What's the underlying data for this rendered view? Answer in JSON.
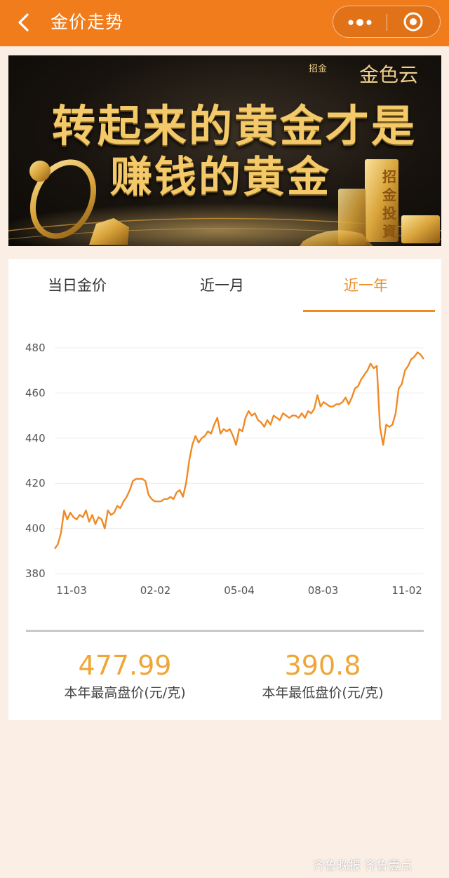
{
  "header": {
    "title": "金价走势",
    "back_icon": "chevron-left-icon",
    "more_icon": "more-dots-icon",
    "close_icon": "target-close-icon",
    "background": "#f07c1c"
  },
  "banner": {
    "badge": "招金",
    "brand": "金色云",
    "headline_1": "转起来的黄金才是",
    "headline_2": "赚钱的黄金",
    "gold_bar_text": "招金投資"
  },
  "tabs": [
    {
      "label": "当日金价",
      "active": false
    },
    {
      "label": "近一月",
      "active": false
    },
    {
      "label": "近一年",
      "active": true
    }
  ],
  "accent_color": "#f08a24",
  "chart_data": {
    "type": "line",
    "title": "",
    "xlabel": "",
    "ylabel": "",
    "ylim": [
      380,
      480
    ],
    "yticks": [
      380,
      400,
      420,
      440,
      460,
      480
    ],
    "xtick_labels": [
      "11-03",
      "02-02",
      "05-04",
      "08-03",
      "11-02"
    ],
    "grid": true,
    "series": [
      {
        "color": "#f08a24",
        "values": [
          391,
          393,
          398,
          408,
          404,
          407,
          405,
          404,
          406,
          405,
          408,
          403,
          406,
          402,
          405,
          404,
          400,
          408,
          406,
          407,
          410,
          409,
          412,
          414,
          417,
          421,
          422,
          422,
          422,
          421,
          415,
          413,
          412,
          412,
          412,
          413,
          413,
          414,
          413,
          416,
          417,
          414,
          420,
          430,
          437,
          441,
          438,
          440,
          441,
          443,
          442,
          446,
          449,
          442,
          444,
          443,
          444,
          441,
          437,
          444,
          443,
          449,
          452,
          450,
          451,
          448,
          447,
          445,
          448,
          446,
          450,
          449,
          448,
          451,
          450,
          449,
          450,
          450,
          449,
          451,
          449,
          452,
          451,
          453,
          459,
          454,
          456,
          455,
          454,
          454,
          455,
          455,
          456,
          458,
          455,
          458,
          462,
          463,
          466,
          468,
          470,
          473,
          471,
          472,
          445,
          437,
          446,
          445,
          446,
          451,
          462,
          464,
          470,
          472,
          475,
          476,
          478,
          477,
          475
        ]
      }
    ]
  },
  "stats": {
    "high_value": "477.99",
    "high_label": "本年最高盘价(元/克)",
    "low_value": "390.8",
    "low_label": "本年最低盘价(元/克)"
  },
  "watermark": "齐鲁晚报 齐鲁壹点"
}
